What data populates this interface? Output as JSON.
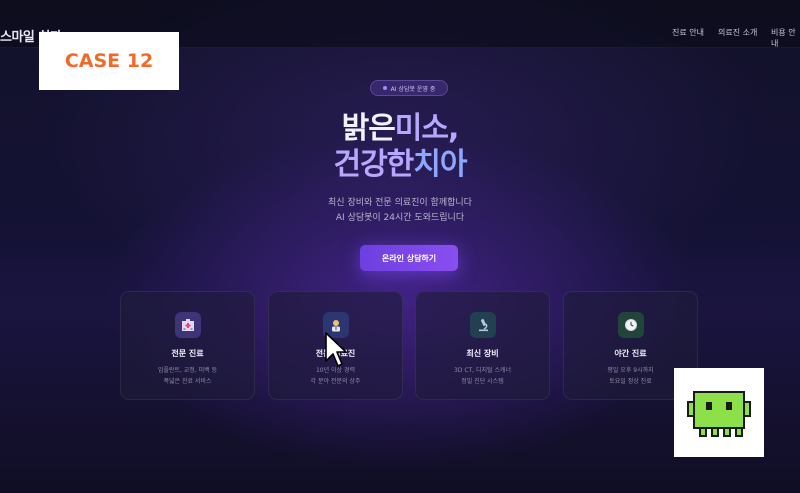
{
  "brand": "스마일 치과",
  "nav": [
    "진료 안내",
    "의료진 소개",
    "비용 안내"
  ],
  "case_label": "CASE 12",
  "status_pill": "AI 상담봇 운영 중",
  "hero": {
    "line1_a": "밝은 ",
    "line1_b": "미소,",
    "line2_a": "건강한 ",
    "line2_b": "치아",
    "sub1": "최신 장비와 전문 의료진이 함께합니다",
    "sub2": "AI 상담봇이 24시간 도와드립니다"
  },
  "cta": "온라인 상담하기",
  "cards": [
    {
      "title": "전문 진료",
      "desc1": "임플란트, 교정, 미백 등",
      "desc2": "폭넓은 진료 서비스",
      "icon": "hospital-icon",
      "color": "#4a3a8a"
    },
    {
      "title": "전문 의료진",
      "desc1": "10년 이상 경력",
      "desc2": "각 분야 전문의 상주",
      "icon": "doctor-icon",
      "color": "#2e3a7a"
    },
    {
      "title": "최신 장비",
      "desc1": "3D CT, 디지털 스캐너",
      "desc2": "정밀 진단 시스템",
      "icon": "microscope-icon",
      "color": "#24425a"
    },
    {
      "title": "야간 진료",
      "desc1": "평일 오후 9시까지",
      "desc2": "토요일 정상 진료",
      "icon": "clock-icon",
      "color": "#23483c"
    }
  ],
  "colors": {
    "accent": "#7b48ea",
    "case_text": "#f06a2a",
    "mascot": "#8ee04a"
  }
}
